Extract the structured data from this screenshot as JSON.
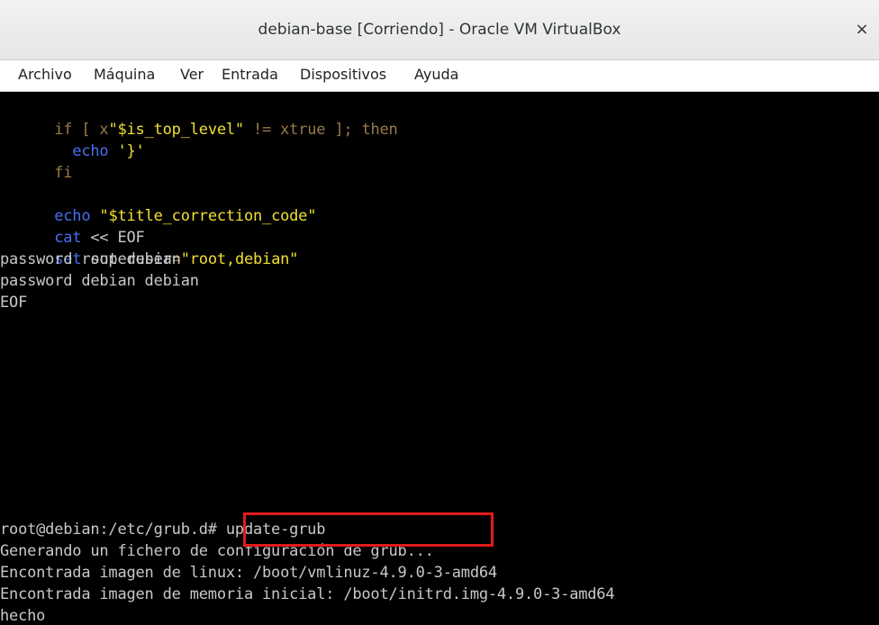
{
  "window": {
    "title": "debian-base [Corriendo] - Oracle VM VirtualBox",
    "close_glyph": "×"
  },
  "menubar": {
    "items": [
      "Archivo",
      "Máquina",
      "Ver",
      "Entrada",
      "Dispositivos",
      "Ayuda"
    ]
  },
  "terminal": {
    "l1": {
      "a": "if",
      "b": " [ x",
      "c": "\"$is_top_level\"",
      "d": " != xtrue ]; ",
      "e": "then"
    },
    "l2": {
      "a": "  echo ",
      "b": "'}'"
    },
    "l3": {
      "a": "fi"
    },
    "l5": {
      "a": "echo ",
      "b": "\"$title_correction_code\""
    },
    "l6": {
      "a": "cat",
      "b": " << EOF"
    },
    "l7": {
      "a": "set",
      "b": " superuser",
      "c": "=",
      "d": "\"root,debian\""
    },
    "l8": "password root debian",
    "l9": "password debian debian",
    "l10": "EOF",
    "prompt": "root@debian:/etc/grub.d# update-grub",
    "out1": "Generando un fichero de configuración de grub...",
    "out2": "Encontrada imagen de linux: /boot/vmlinuz-4.9.0-3-amd64",
    "out3": "Encontrada imagen de memoria inicial: /boot/initrd.img-4.9.0-3-amd64",
    "out4": "hecho"
  },
  "colors": {
    "keyword": "#9a7a4a",
    "string": "#f0e030",
    "command": "#4a6ff0",
    "text": "#c8c8c8",
    "highlight": "#e21a1a"
  }
}
